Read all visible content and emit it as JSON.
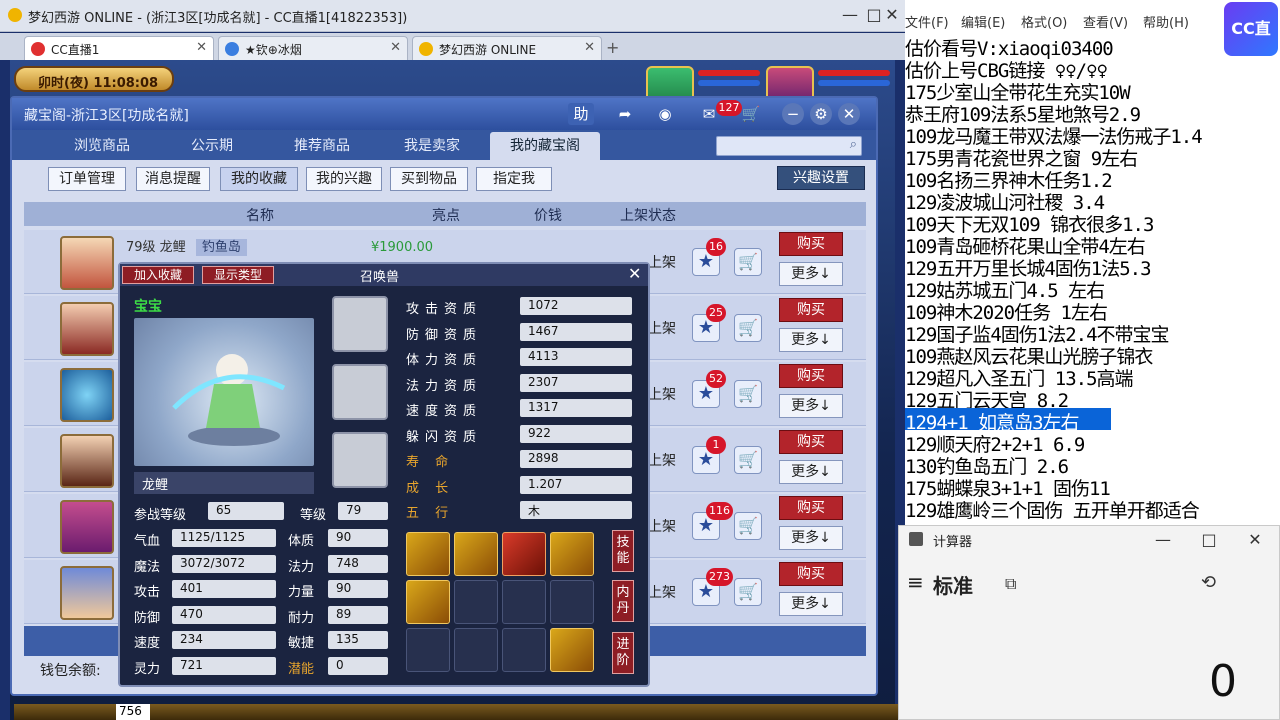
{
  "browser": {
    "title": "梦幻西游 ONLINE - (浙江3区[功成名就] - CC直播1[41822353])",
    "tabs": [
      {
        "label": "CC直播1"
      },
      {
        "label": "★钦⊕冰烟"
      },
      {
        "label": "梦幻西游 ONLINE"
      }
    ],
    "new_tab": "+",
    "minimize": "—",
    "restore": "□",
    "close": "✕"
  },
  "game": {
    "clock": "卯时(夜)  11:08:08",
    "panel": {
      "title": "藏宝阁-浙江3区[功成名就]",
      "help": "助",
      "badge_count": "127",
      "nav_tabs": [
        "浏览商品",
        "公示期",
        "推荐商品",
        "我是卖家",
        "我的藏宝阁"
      ],
      "active_nav": 4,
      "sub_tabs": [
        "订单管理",
        "消息提醒",
        "我的收藏",
        "我的兴趣",
        "买到物品",
        "指定我"
      ],
      "active_sub": 2,
      "interest_settings": "兴趣设置",
      "headers": {
        "name": "名称",
        "highlight": "亮点",
        "price": "价钱",
        "status": "上架状态"
      },
      "first_row": {
        "level_name": "79级  龙鲤",
        "tag": "钓鱼岛",
        "price": "¥1900.00",
        "status": "正在上架"
      },
      "rows": [
        {
          "status": "上架",
          "count": "16"
        },
        {
          "status": "上架",
          "count": "25"
        },
        {
          "status": "上架",
          "count": "52"
        },
        {
          "status": "上架",
          "count": "1"
        },
        {
          "status": "上架",
          "count": "116"
        },
        {
          "status": "上架",
          "count": "273"
        }
      ],
      "buy_label": "购买",
      "more_label": "更多↓",
      "wallet_label": "钱包余额:"
    },
    "pet_popup": {
      "add_favorite": "加入收藏",
      "show_type": "显示类型",
      "title": "召唤兽",
      "close": "✕",
      "baby_label": "宝宝",
      "name": "龙鲤",
      "aptitudes": [
        {
          "label": "攻击资质",
          "value": "1072",
          "gold": false
        },
        {
          "label": "防御资质",
          "value": "1467",
          "gold": false
        },
        {
          "label": "体力资质",
          "value": "4113",
          "gold": false
        },
        {
          "label": "法力资质",
          "value": "2307",
          "gold": false
        },
        {
          "label": "速度资质",
          "value": "1317",
          "gold": false
        },
        {
          "label": "躲闪资质",
          "value": "922",
          "gold": false
        },
        {
          "label": "寿      命",
          "value": "2898",
          "gold": true
        },
        {
          "label": "成      长",
          "value": "1.207",
          "gold": true
        },
        {
          "label": "五      行",
          "value": "木",
          "gold": true
        }
      ],
      "battle_level_label": "参战等级",
      "battle_level": "65",
      "level_label": "等级",
      "level": "79",
      "stats_left": [
        {
          "label": "气血",
          "value": "1125/1125"
        },
        {
          "label": "魔法",
          "value": "3072/3072"
        },
        {
          "label": "攻击",
          "value": "401"
        },
        {
          "label": "防御",
          "value": "470"
        },
        {
          "label": "速度",
          "value": "234"
        },
        {
          "label": "灵力",
          "value": "721"
        }
      ],
      "stats_right": [
        {
          "label": "体质",
          "value": "90"
        },
        {
          "label": "法力",
          "value": "748"
        },
        {
          "label": "力量",
          "value": "90"
        },
        {
          "label": "耐力",
          "value": "89"
        },
        {
          "label": "敏捷",
          "value": "135"
        },
        {
          "label": "潜能",
          "value": "0"
        }
      ],
      "side_buttons": [
        "技能",
        "内丹",
        "进阶"
      ]
    },
    "chat_input": "756"
  },
  "notepad": {
    "menu": [
      "文件(F)",
      "编辑(E)",
      "格式(O)",
      "查看(V)",
      "帮助(H)"
    ],
    "lines": [
      "估价看号V:xiaoqi03400",
      "估价上号CBG链接 ♀♀/♀♀",
      "175少室山全带花生充实10W",
      "恭王府109法系5星地煞号2.9",
      "109龙马魔王带双法爆一法伤戒子1.4",
      "175男青花瓷世界之窗   9左右",
      "109名扬三界神木任务1.2",
      "129凌波城山河社稷   3.4",
      "109天下无双109   锦衣很多1.3",
      "109青岛砸桥花果山全带4左右",
      "129五开万里长城4固伤1法5.3",
      "129姑苏城五门4.5  左右",
      "109神木2020任务   1左右",
      "129国子监4固伤1法2.4不带宝宝",
      "109燕赵风云花果山光膀子锦衣",
      "129超凡入圣五门   13.5高端",
      "129五门云天宫 8.2",
      "1294+1  如意岛3左右",
      "129顺天府2+2+1   6.9",
      "130钓鱼岛五门   2.6",
      "175蝴蝶泉3+1+1  固伤11",
      "129雄鹰岭三个固伤  五开单开都适合"
    ],
    "selected_line": 17,
    "cc_logo": "CC直播"
  },
  "calculator": {
    "title": "计算器",
    "mode": "标准",
    "display": "0"
  }
}
